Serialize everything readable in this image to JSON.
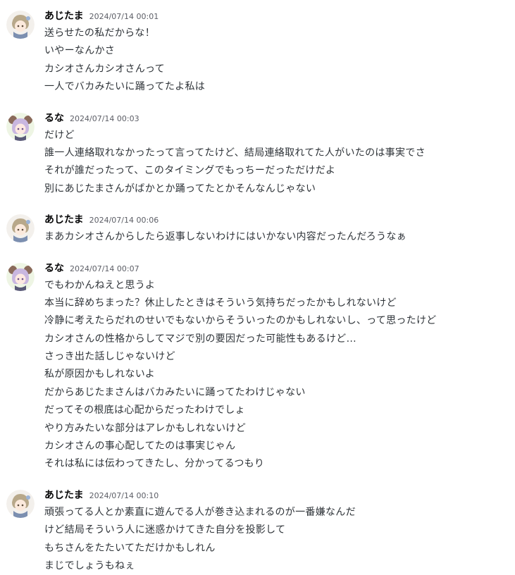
{
  "messages": [
    {
      "author": "あじたま",
      "avatar": "ajitama-avatar",
      "timestamp": "2024/07/14 00:01",
      "lines": [
        "送らせたの私だからな！",
        "いやーなんかさ",
        "カシオさんカシオさんって",
        "一人でバカみたいに踊ってたよ私は"
      ]
    },
    {
      "author": "るな",
      "avatar": "runa-avatar",
      "timestamp": "2024/07/14 00:03",
      "lines": [
        "だけど",
        "誰一人連絡取れなかったって言ってたけど、結局連絡取れてた人がいたのは事実でさ",
        "それが誰だったって、このタイミングでもっちーだっただけだよ",
        "別にあじたまさんがばかとか踊ってたとかそんなんじゃない"
      ]
    },
    {
      "author": "あじたま",
      "avatar": "ajitama-avatar",
      "timestamp": "2024/07/14 00:06",
      "lines": [
        "まあカシオさんからしたら返事しないわけにはいかない内容だったんだろうなぁ"
      ]
    },
    {
      "author": "るな",
      "avatar": "runa-avatar",
      "timestamp": "2024/07/14 00:07",
      "lines": [
        "でもわかんねえと思うよ",
        "本当に辞めちまった？休止したときはそういう気持ちだったかもしれないけど",
        "冷静に考えたらだれのせいでもないからそういったのかもしれないし、って思ったけど",
        "カシオさんの性格からしてマジで別の要因だった可能性もあるけど...",
        "さっき出た話しじゃないけど",
        "私が原因かもしれないよ",
        "だからあじたまさんはバカみたいに踊ってたわけじゃない",
        "だってその根底は心配からだったわけでしょ",
        "やり方みたいな部分はアレかもしれないけど",
        "カシオさんの事心配してたのは事実じゃん",
        "それは私には伝わってきたし、分かってるつもり"
      ]
    },
    {
      "author": "あじたま",
      "avatar": "ajitama-avatar",
      "timestamp": "2024/07/14 00:10",
      "lines": [
        "頑張ってる人とか素直に遊んでる人が巻き込まれるのが一番嫌なんだ",
        "けど結局そういう人に迷惑かけてきた自分を投影して",
        "もちさんをたたいてただけかもしれん",
        "まじでしょうもねぇ"
      ]
    }
  ]
}
